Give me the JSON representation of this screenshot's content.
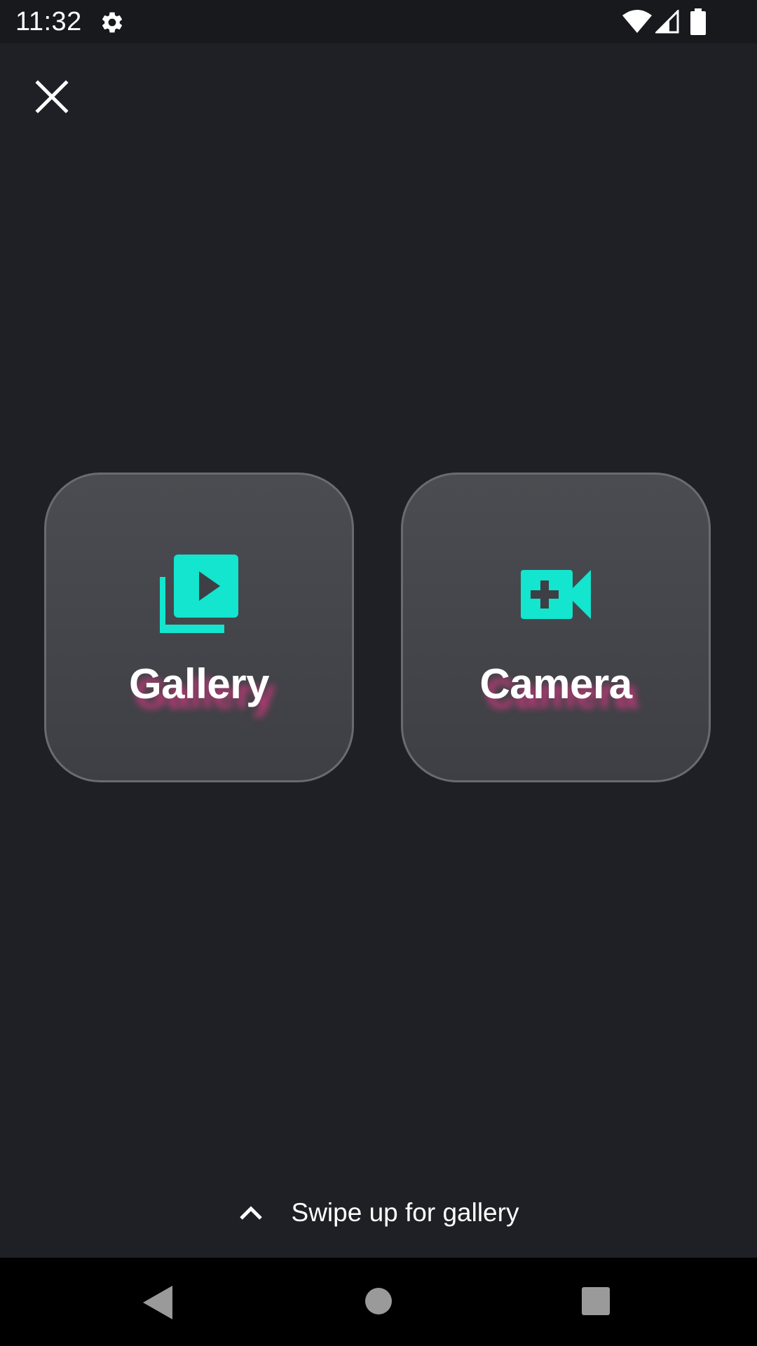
{
  "status_bar": {
    "time": "11:32",
    "icons": [
      "gear-icon",
      "wifi-icon",
      "signal-icon",
      "battery-icon"
    ]
  },
  "close_button": {
    "icon": "close-icon"
  },
  "options": [
    {
      "label": "Gallery",
      "icon": "video-library-icon"
    },
    {
      "label": "Camera",
      "icon": "video-camera-add-icon"
    }
  ],
  "swipe_hint": {
    "icon": "chevron-up-icon",
    "text": "Swipe up for gallery"
  },
  "nav_bar": {
    "buttons": [
      "back-icon",
      "home-icon",
      "recents-icon"
    ]
  },
  "colors": {
    "background": "#1f2025",
    "tile": "#45464b",
    "accent_icon": "#13e5cf",
    "label_shadow": "#d63882"
  }
}
